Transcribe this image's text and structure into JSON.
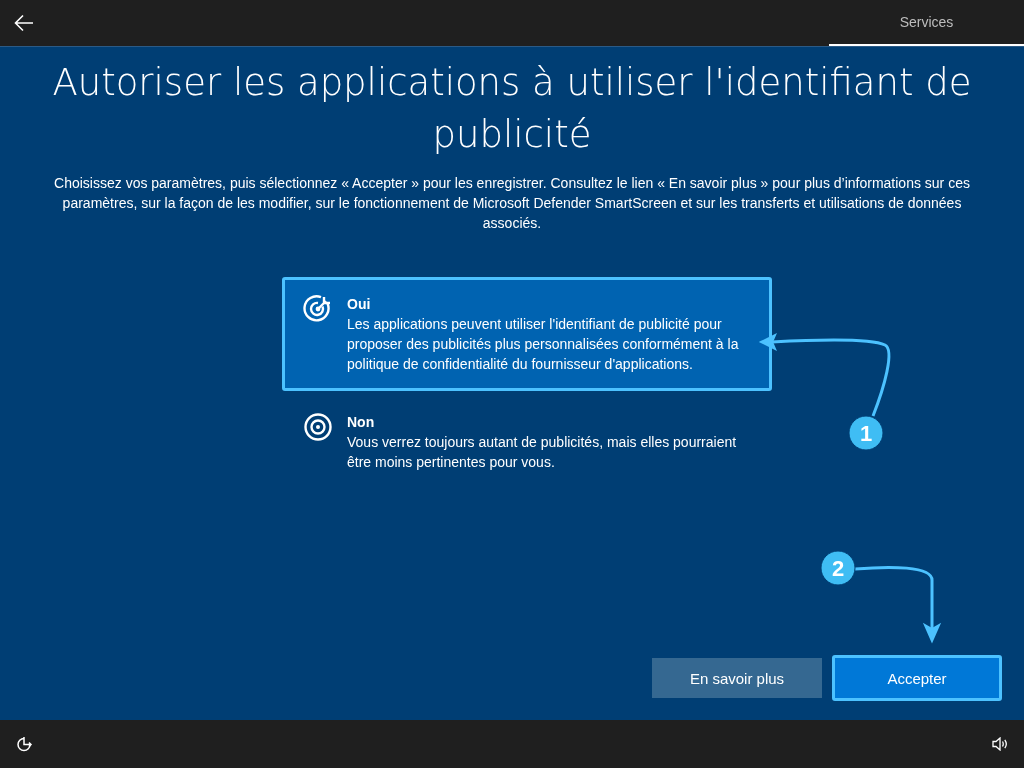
{
  "header": {
    "tab": "Services"
  },
  "title": "Autoriser les applications à utiliser l'identifiant de publicité",
  "description": "Choisissez vos paramètres, puis sélectionnez « Accepter » pour les enregistrer. Consultez le lien « En savoir plus » pour plus d’informations sur ces paramètres, sur la façon de les modifier, sur le fonctionnement de Microsoft Defender SmartScreen et sur les transferts et utilisations de données associés.",
  "options": [
    {
      "kind": "target",
      "title": "Oui",
      "text": "Les applications peuvent utiliser l'identifiant de publicité pour proposer des publicités plus personnalisées conformément à la politique de confidentialité du fournisseur d'applications.",
      "selected": true
    },
    {
      "kind": "bullseye",
      "title": "Non",
      "text": "Vous verrez toujours autant de publicités, mais elles pourraient être moins pertinentes pour vous.",
      "selected": false
    }
  ],
  "buttons": [
    {
      "label": "En savoir plus",
      "kind": "secondary"
    },
    {
      "label": "Accepter",
      "kind": "primary"
    }
  ],
  "annotations": [
    {
      "number": "1"
    },
    {
      "number": "2"
    }
  ]
}
